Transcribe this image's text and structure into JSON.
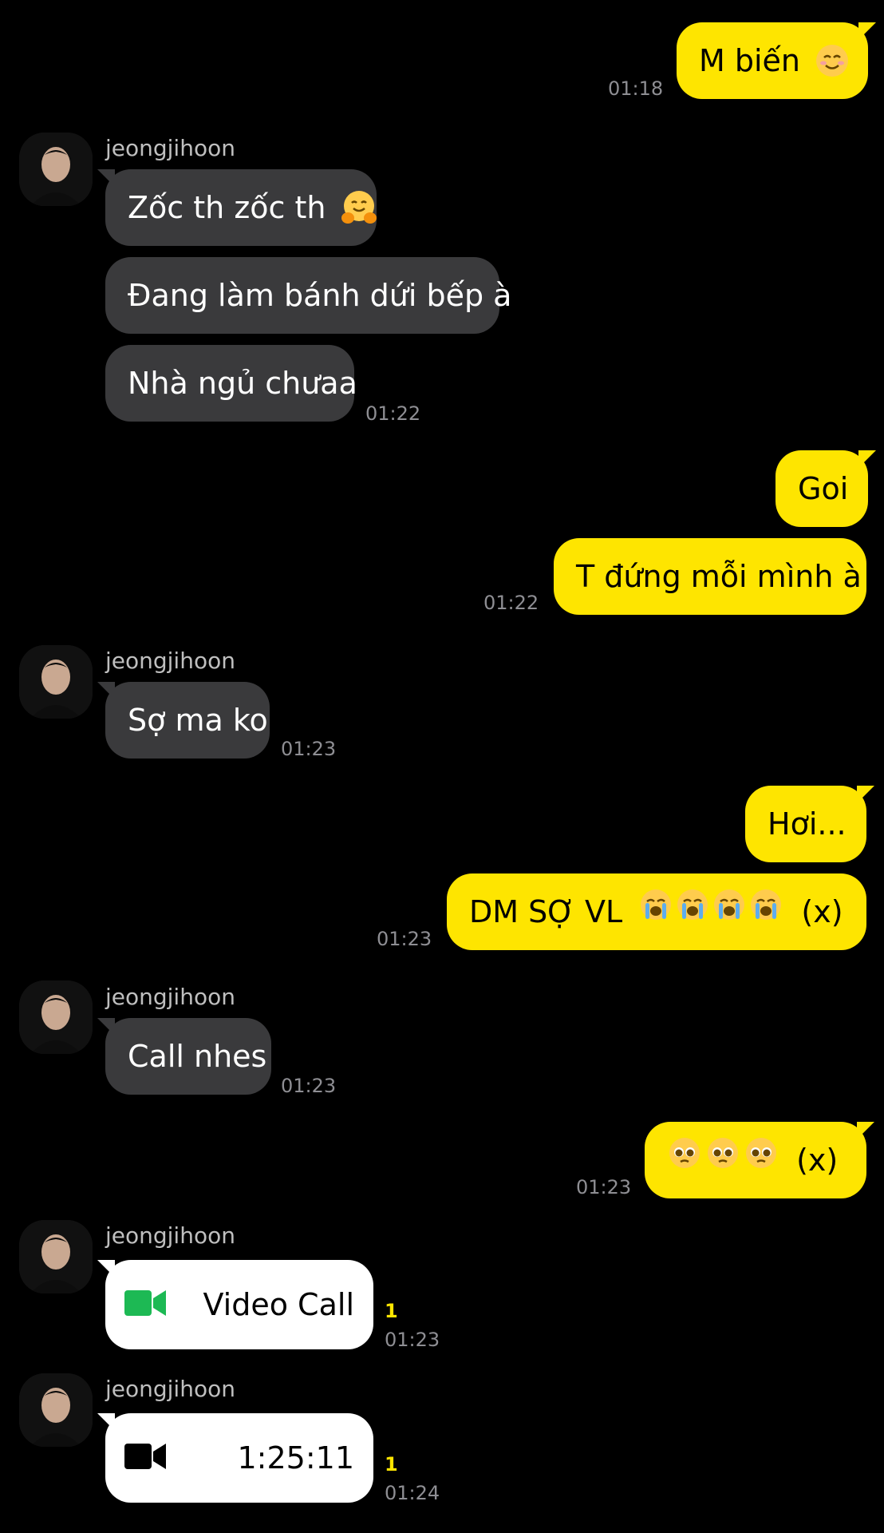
{
  "sender_name": "jeongjihoon",
  "colors": {
    "outgoing_bubble": "#fee500",
    "incoming_bubble": "#3a3a3c",
    "call_card": "#ffffff",
    "video_call_icon": "#1db954",
    "unread": "#fee500",
    "background": "#000000"
  },
  "messages": [
    {
      "from": "me",
      "text": "M biến",
      "emoji": "smiling-face-icon",
      "time": "01:18"
    },
    {
      "from": "jeongjihoon",
      "text": "Zốc th zốc th",
      "emoji": "hugging-face-icon"
    },
    {
      "from": "jeongjihoon",
      "text": "Đang làm bánh dứi bếp à"
    },
    {
      "from": "jeongjihoon",
      "text": "Nhà ngủ chưaa",
      "time": "01:22"
    },
    {
      "from": "me",
      "text": "Goi"
    },
    {
      "from": "me",
      "text": "T đứng mỗi mình à",
      "time": "01:22"
    },
    {
      "from": "jeongjihoon",
      "text": "Sợ ma ko",
      "time": "01:23"
    },
    {
      "from": "me",
      "text": "Hơi..."
    },
    {
      "from": "me",
      "text": "DM SỢ VL",
      "emoji": "loudly-crying-face-icon",
      "emoji_count": 4,
      "suffix": "(x)",
      "time": "01:23"
    },
    {
      "from": "jeongjihoon",
      "text": "Call nhes",
      "time": "01:23"
    },
    {
      "from": "me",
      "emoji": "pleading-face-icon",
      "emoji_count": 3,
      "suffix": "(x)",
      "time": "01:23"
    },
    {
      "from": "jeongjihoon",
      "type": "video-call",
      "label": "Video Call",
      "icon": "video-camera-icon",
      "unread": "1",
      "time": "01:23"
    },
    {
      "from": "jeongjihoon",
      "type": "video-call-ended",
      "label": "1:25:11",
      "icon": "video-camera-icon",
      "unread": "1",
      "time": "01:24"
    }
  ]
}
